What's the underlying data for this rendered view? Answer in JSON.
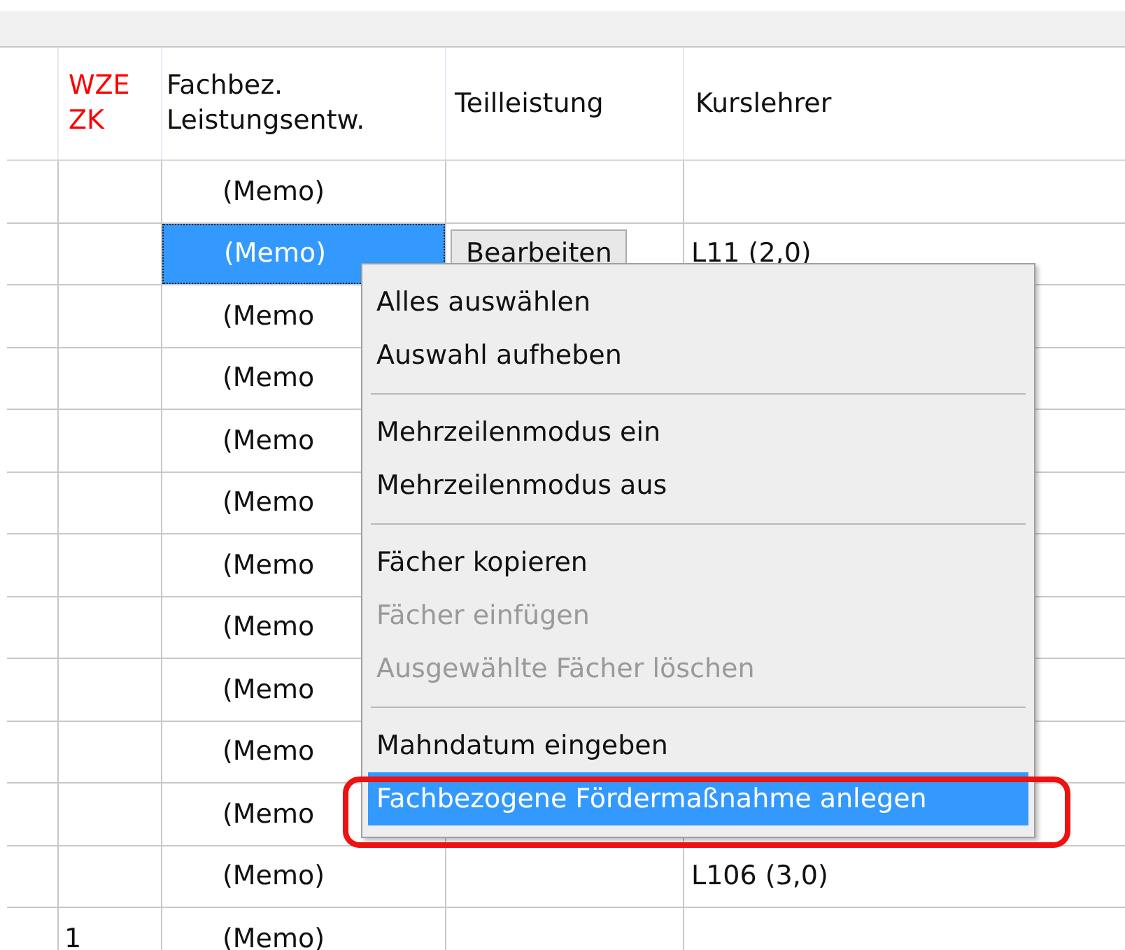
{
  "table": {
    "columns": [
      {},
      {
        "label": "WZE\nZK",
        "highlight": true
      },
      {
        "label": "Fachbez.\nLeistungsentw.",
        "highlight": false
      },
      {
        "label": "Teilleistung",
        "highlight": false
      },
      {
        "label": "Kurslehrer",
        "highlight": false
      }
    ],
    "rows": [
      {
        "selected": false,
        "cells": [
          "",
          "",
          "(Memo)",
          "",
          ""
        ]
      },
      {
        "selected": true,
        "cells": [
          "",
          "",
          "(Memo)",
          "Bearbeiten",
          "L11 (2,0)"
        ]
      },
      {
        "selected": false,
        "cells": [
          "",
          "",
          "(Memo",
          "",
          ""
        ]
      },
      {
        "selected": false,
        "cells": [
          "",
          "",
          "(Memo",
          "",
          ""
        ]
      },
      {
        "selected": false,
        "cells": [
          "",
          "",
          "(Memo",
          "",
          ""
        ]
      },
      {
        "selected": false,
        "cells": [
          "",
          "",
          "(Memo",
          "",
          ""
        ]
      },
      {
        "selected": false,
        "cells": [
          "",
          "",
          "(Memo",
          "",
          ""
        ]
      },
      {
        "selected": false,
        "cells": [
          "",
          "",
          "(Memo",
          "",
          ""
        ]
      },
      {
        "selected": false,
        "cells": [
          "",
          "",
          "(Memo",
          "",
          ""
        ]
      },
      {
        "selected": false,
        "cells": [
          "",
          "",
          "(Memo",
          "",
          ""
        ]
      },
      {
        "selected": false,
        "cells": [
          "",
          "",
          "(Memo",
          "",
          ""
        ]
      },
      {
        "selected": false,
        "cells": [
          "",
          "",
          "(Memo)",
          "",
          "L106 (3,0)"
        ]
      },
      {
        "selected": false,
        "cells": [
          "",
          "1",
          "(Memo)",
          "",
          ""
        ]
      }
    ]
  },
  "context_menu": {
    "items": [
      {
        "kind": "item",
        "label": "Alles auswählen",
        "disabled": false,
        "selected": false
      },
      {
        "kind": "item",
        "label": "Auswahl aufheben",
        "disabled": false,
        "selected": false
      },
      {
        "kind": "separator"
      },
      {
        "kind": "item",
        "label": "Mehrzeilenmodus ein",
        "disabled": false,
        "selected": false
      },
      {
        "kind": "item",
        "label": "Mehrzeilenmodus aus",
        "disabled": false,
        "selected": false
      },
      {
        "kind": "separator"
      },
      {
        "kind": "item",
        "label": "Fächer kopieren",
        "disabled": false,
        "selected": false
      },
      {
        "kind": "item",
        "label": "Fächer einfügen",
        "disabled": true,
        "selected": false
      },
      {
        "kind": "item",
        "label": "Ausgewählte Fächer löschen",
        "disabled": true,
        "selected": false
      },
      {
        "kind": "separator"
      },
      {
        "kind": "item",
        "label": "Mahndatum eingeben",
        "disabled": false,
        "selected": false
      },
      {
        "kind": "item",
        "label": "Fachbezogene Fördermaßnahme anlegen",
        "disabled": false,
        "selected": true,
        "annotated": true
      }
    ]
  }
}
